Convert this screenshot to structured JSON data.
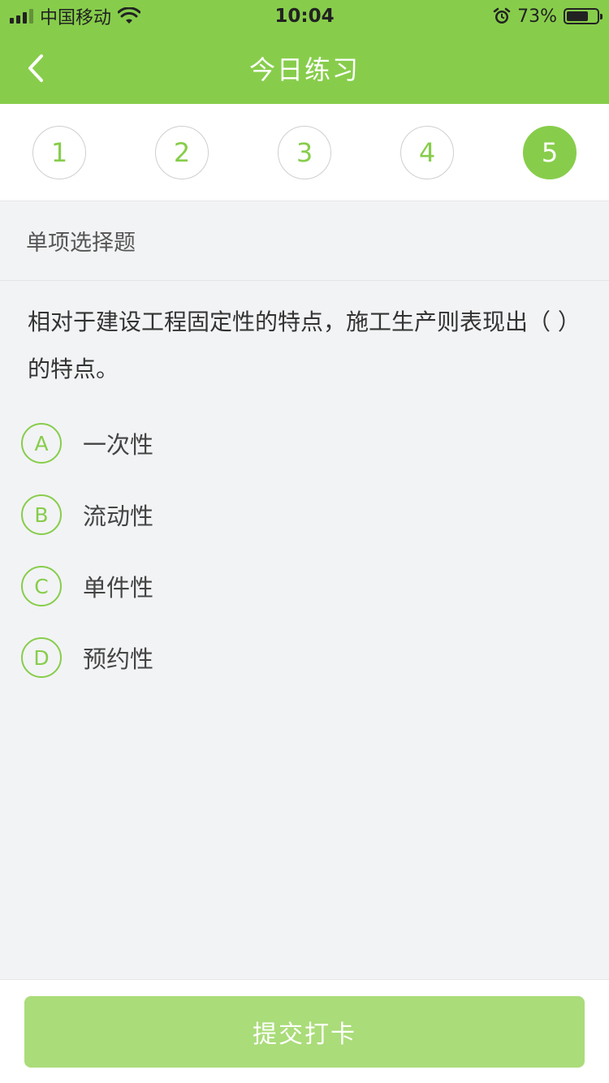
{
  "status_bar": {
    "carrier": "中国移动",
    "time": "10:04",
    "battery_percent": "73%",
    "battery_level": 0.73
  },
  "nav": {
    "title": "今日练习"
  },
  "steps": [
    {
      "label": "1",
      "active": false
    },
    {
      "label": "2",
      "active": false
    },
    {
      "label": "3",
      "active": false
    },
    {
      "label": "4",
      "active": false
    },
    {
      "label": "5",
      "active": true
    }
  ],
  "question": {
    "type": "单项选择题",
    "text": "相对于建设工程固定性的特点，施工生产则表现出（ ）的特点。",
    "options": [
      {
        "letter": "A",
        "text": "一次性"
      },
      {
        "letter": "B",
        "text": "流动性"
      },
      {
        "letter": "C",
        "text": "单件性"
      },
      {
        "letter": "D",
        "text": "预约性"
      }
    ]
  },
  "footer": {
    "submit_label": "提交打卡"
  },
  "colors": {
    "primary": "#87cd4b",
    "submit_bg": "#aadc79",
    "page_bg": "#f2f3f5"
  }
}
